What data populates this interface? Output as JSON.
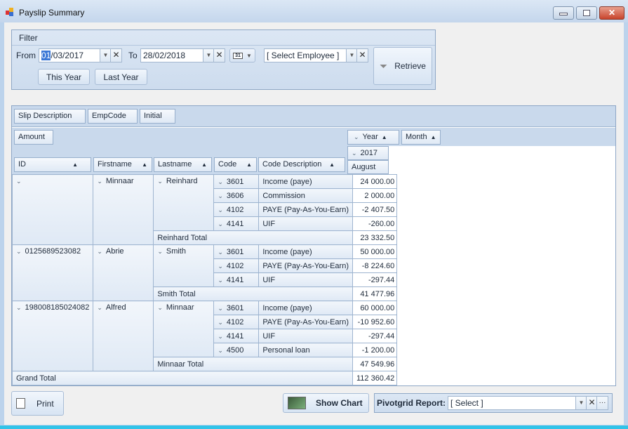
{
  "window": {
    "title": "Payslip Summary",
    "minimize": "minimize",
    "maximize": "maximize",
    "close": "✕"
  },
  "filter": {
    "group_label": "Filter",
    "from_label": "From",
    "from_value_selected": "01",
    "from_value_rest": "/03/2017",
    "to_label": "To",
    "to_value": "28/02/2018",
    "calendar_icon_text": "31",
    "employee_value": "[ Select Employee ]",
    "this_year": "This Year",
    "last_year": "Last Year",
    "retrieve": "Retrieve"
  },
  "pivot": {
    "filter_fields": [
      "Slip Description",
      "EmpCode",
      "Initial"
    ],
    "data_field": "Amount",
    "column_fields": [
      "Year",
      "Month"
    ],
    "row_fields": [
      "ID",
      "Firstname",
      "Lastname",
      "Code",
      "Code Description"
    ],
    "column_year": "2017",
    "column_month": "August",
    "groups": [
      {
        "id": "",
        "firstname": "Minnaar",
        "lastname": "Reinhard",
        "total_label": "Reinhard Total",
        "total": "23 332.50",
        "items": [
          {
            "code": "3601",
            "desc": "Income (paye)",
            "value": "24 000.00"
          },
          {
            "code": "3606",
            "desc": "Commission",
            "value": "2 000.00"
          },
          {
            "code": "4102",
            "desc": "PAYE (Pay-As-You-Earn)",
            "value": "-2 407.50"
          },
          {
            "code": "4141",
            "desc": "UIF",
            "value": "-260.00"
          }
        ]
      },
      {
        "id": "0125689523082",
        "firstname": "Abrie",
        "lastname": "Smith",
        "total_label": "Smith Total",
        "total": "41 477.96",
        "items": [
          {
            "code": "3601",
            "desc": "Income (paye)",
            "value": "50 000.00"
          },
          {
            "code": "4102",
            "desc": "PAYE (Pay-As-You-Earn)",
            "value": "-8 224.60"
          },
          {
            "code": "4141",
            "desc": "UIF",
            "value": "-297.44"
          }
        ]
      },
      {
        "id": "198008185024082",
        "firstname": "Alfred",
        "lastname": "Minnaar",
        "total_label": "Minnaar Total",
        "total": "47 549.96",
        "items": [
          {
            "code": "3601",
            "desc": "Income (paye)",
            "value": "60 000.00"
          },
          {
            "code": "4102",
            "desc": "PAYE (Pay-As-You-Earn)",
            "value": "-10 952.60"
          },
          {
            "code": "4141",
            "desc": "UIF",
            "value": "-297.44"
          },
          {
            "code": "4500",
            "desc": "Personal loan",
            "value": "-1 200.00"
          }
        ]
      }
    ],
    "grand_total_label": "Grand Total",
    "grand_total": "112 360.42"
  },
  "footer": {
    "print": "Print",
    "show_chart": "Show Chart",
    "report_label": "Pivotgrid Report:",
    "report_value": "[ Select ]",
    "ellipsis": "···"
  }
}
